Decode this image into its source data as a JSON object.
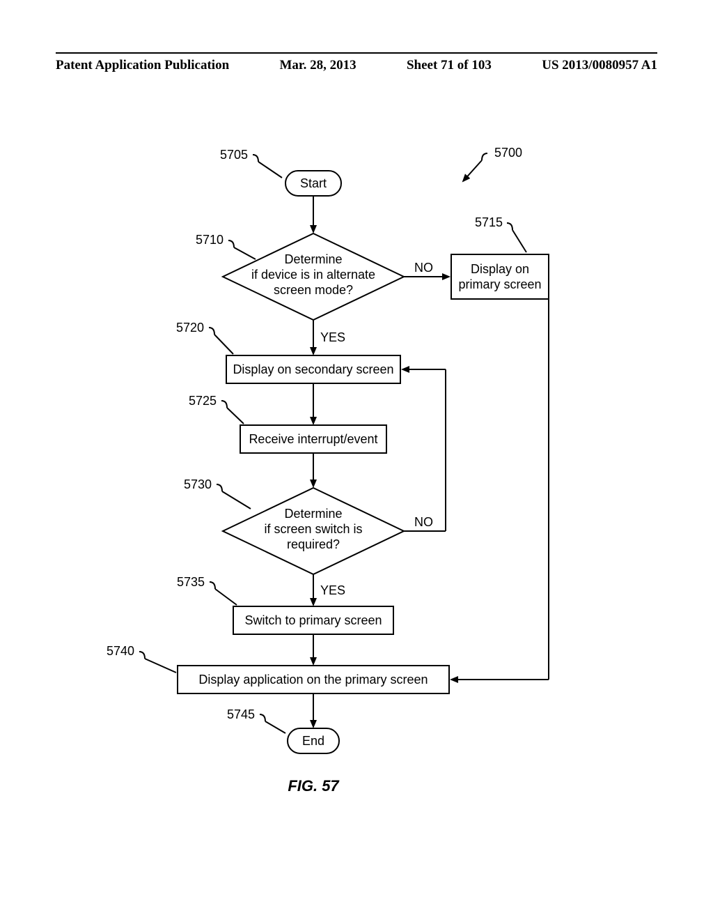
{
  "header": {
    "left": "Patent Application Publication",
    "date": "Mar. 28, 2013",
    "sheet": "Sheet 71 of 103",
    "pubno": "US 2013/0080957 A1"
  },
  "labels": {
    "n5700": "5700",
    "n5705": "5705",
    "n5710": "5710",
    "n5715": "5715",
    "n5720": "5720",
    "n5725": "5725",
    "n5730": "5730",
    "n5735": "5735",
    "n5740": "5740",
    "n5745": "5745"
  },
  "nodes": {
    "start": "Start",
    "end": "End",
    "d1_l1": "Determine",
    "d1_l2": "if device is in alternate",
    "d1_l3": "screen mode?",
    "d2_l1": "Determine",
    "d2_l2": "if screen switch is",
    "d2_l3": "required?",
    "p5715_l1": "Display on",
    "p5715_l2": "primary screen",
    "p5720": "Display on secondary screen",
    "p5725": "Receive interrupt/event",
    "p5735": "Switch to primary screen",
    "p5740": "Display application on the primary  screen"
  },
  "edges": {
    "yes": "YES",
    "no": "NO"
  },
  "figure": "FIG. 57"
}
